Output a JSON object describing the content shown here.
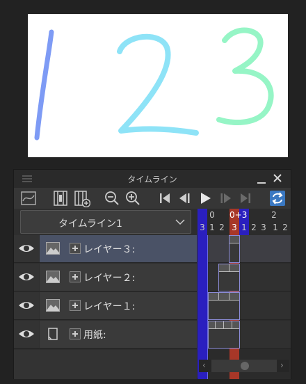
{
  "canvas": {
    "background": "#ffffff",
    "stroke_colors": {
      "one": "#7e9bf5",
      "two": "#8ee3f7",
      "three": "#96f5c6"
    }
  },
  "panel": {
    "title": "タイムライン",
    "toolbar": {
      "icons": [
        "graph-icon",
        "cel-spec-icon",
        "new-cel-icon",
        "zoom-out-icon",
        "zoom-in-icon",
        "first-frame-icon",
        "prev-frame-icon",
        "play-icon",
        "next-frame-icon",
        "last-frame-icon",
        "loop-icon"
      ]
    },
    "timeline_select": {
      "value": "タイムライン1"
    },
    "layers": [
      {
        "label": "レイヤー３:",
        "active": true,
        "icon": "raster-layer-icon"
      },
      {
        "label": "レイヤー２:",
        "active": false,
        "icon": "raster-layer-icon"
      },
      {
        "label": "レイヤー１:",
        "active": false,
        "icon": "raster-layer-icon"
      },
      {
        "label": "用紙:",
        "active": false,
        "icon": "paper-layer-icon"
      }
    ],
    "frames": {
      "top_labels": {
        "a": "0",
        "b": "0+3",
        "c": "2"
      },
      "bottom_labels": [
        "3",
        "1",
        "2",
        "3",
        "1",
        "2",
        "3",
        "1",
        "2"
      ]
    },
    "colors": {
      "playhead_blue": "#2a1fbf",
      "current_frame_red": "#a83728",
      "active_layer": "#4a5266",
      "loop_accent": "#3a78c2"
    }
  }
}
